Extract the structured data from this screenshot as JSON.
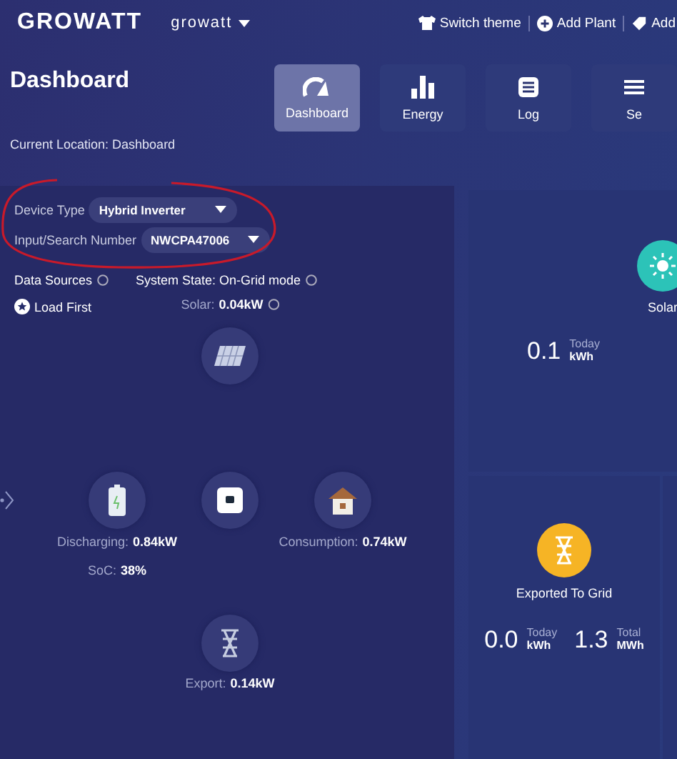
{
  "header": {
    "logo": "GROWATT",
    "account": "growatt",
    "actions": [
      {
        "kind": "shirt",
        "label": "Switch theme"
      },
      {
        "kind": "plus",
        "label": "Add Plant"
      },
      {
        "kind": "tag",
        "label": "Add"
      }
    ]
  },
  "page_title": "Dashboard",
  "nav_tabs": [
    {
      "kind": "gauge",
      "label": "Dashboard",
      "selected": true
    },
    {
      "kind": "bars",
      "label": "Energy",
      "selected": false
    },
    {
      "kind": "log",
      "label": "Log",
      "selected": false
    },
    {
      "kind": "settings",
      "label": "Se",
      "selected": false
    }
  ],
  "breadcrumb": "Current Location: Dashboard",
  "filters": [
    {
      "label": "Device Type",
      "value": "Hybrid Inverter"
    },
    {
      "label": "Input/Search Number",
      "value": "NWCPA47006"
    }
  ],
  "flow": {
    "data_sources": "Data Sources",
    "load_first": "Load First",
    "system_state_label": "System State:",
    "system_state": "On-Grid mode",
    "nodes": [
      {
        "kind": "solar",
        "label": "Solar:",
        "value": "0.04kW"
      },
      {
        "kind": "battery",
        "label": "Discharging:",
        "value": "0.84kW"
      },
      {
        "kind": "inverter"
      },
      {
        "kind": "home",
        "label": "Consumption:",
        "value": "0.74kW"
      },
      {
        "kind": "grid",
        "label": "Export:",
        "value": "0.14kW"
      }
    ],
    "soc_label": "SoC:",
    "soc": "38%"
  },
  "solar_card": {
    "title": "Solar",
    "value": "0.1",
    "period": "Today",
    "unit": "kWh"
  },
  "export_card": {
    "title": "Exported To Grid",
    "stats": [
      {
        "value": "0.0",
        "period": "Today",
        "unit": "kWh"
      },
      {
        "value": "1.3",
        "period": "Total",
        "unit": "MWh"
      }
    ]
  }
}
